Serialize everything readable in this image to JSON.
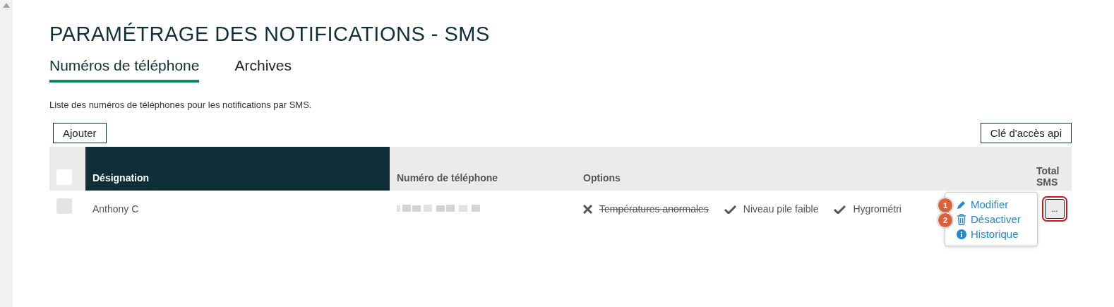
{
  "title": "PARAMÉTRAGE DES NOTIFICATIONS - SMS",
  "tabs": [
    {
      "label": "Numéros de téléphone",
      "selected": true
    },
    {
      "label": "Archives",
      "selected": false
    }
  ],
  "description": "Liste des numéros de téléphones pour les notifications par SMS.",
  "buttons": {
    "add": "Ajouter",
    "api_key": "Clé d'accès api"
  },
  "table": {
    "header_checked": false,
    "columns": [
      {
        "label": "Désignation",
        "highlighted": true
      },
      {
        "label": "Numéro de téléphone",
        "highlighted": false
      },
      {
        "label": "Options",
        "highlighted": false
      },
      {
        "label": "Total SMS",
        "highlighted": false
      }
    ],
    "rows": [
      {
        "checked": false,
        "designation": "Anthony C",
        "options": [
          {
            "label": "Températures anormales",
            "enabled": false
          },
          {
            "label": "Niveau pile faible",
            "enabled": true
          },
          {
            "label": "Hygrométri",
            "enabled": true
          }
        ],
        "actions_button": {
          "label": "...",
          "focused": true
        }
      }
    ]
  },
  "menu": {
    "items": [
      {
        "label": "Modifier",
        "kind": "pencil",
        "badge": "1"
      },
      {
        "label": "Désactiver",
        "kind": "trash",
        "badge": "2"
      },
      {
        "label": "Historique",
        "kind": "info"
      }
    ]
  }
}
